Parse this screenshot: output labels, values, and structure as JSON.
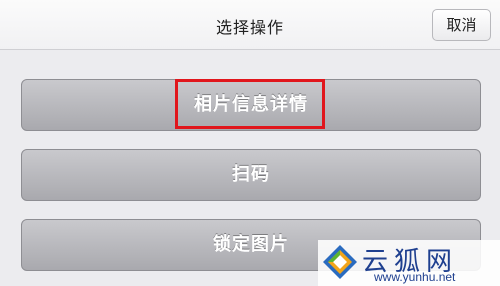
{
  "header": {
    "title": "选择操作",
    "cancel_label": "取消"
  },
  "actions": [
    {
      "label": "相片信息详情"
    },
    {
      "label": "扫码"
    },
    {
      "label": "锁定图片"
    }
  ],
  "annotation": {
    "highlight_color": "#e1161c"
  },
  "watermark": {
    "name": "云狐网",
    "url": "www.yunhu.net",
    "logo_icon": "yunhu-logo-icon"
  }
}
